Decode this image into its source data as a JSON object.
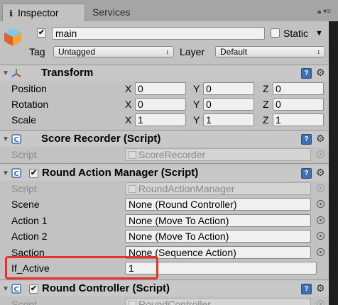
{
  "tabs": {
    "inspector_label": "Inspector",
    "services_label": "Services",
    "lock_icon": "lock-icon",
    "menu_icon": "menu-icon"
  },
  "gameobject": {
    "active_checked": true,
    "name": "main",
    "static_label": "Static",
    "tag_label": "Tag",
    "tag_value": "Untagged",
    "layer_label": "Layer",
    "layer_value": "Default"
  },
  "transform": {
    "title": "Transform",
    "rows": [
      {
        "label": "Position",
        "x": "0",
        "y": "0",
        "z": "0"
      },
      {
        "label": "Rotation",
        "x": "0",
        "y": "0",
        "z": "0"
      },
      {
        "label": "Scale",
        "x": "1",
        "y": "1",
        "z": "1"
      }
    ],
    "axis_x": "X",
    "axis_y": "Y",
    "axis_z": "Z"
  },
  "score_recorder": {
    "title": "Score Recorder (Script)",
    "script_label": "Script",
    "script_value": "ScoreRecorder"
  },
  "round_action_manager": {
    "title": "Round Action Manager (Script)",
    "script_label": "Script",
    "script_value": "RoundActionManager",
    "scene_label": "Scene",
    "scene_value": "None (Round Controller)",
    "action1_label": "Action 1",
    "action1_value": "None (Move To Action)",
    "action2_label": "Action 2",
    "action2_value": "None (Move To Action)",
    "saction_label": "Saction",
    "saction_value": "None (Sequence Action)",
    "ifactive_label": "If_Active",
    "ifactive_value": "1"
  },
  "round_controller": {
    "title": "Round Controller (Script)",
    "script_label": "Script",
    "script_value": "RoundController"
  },
  "colors": {
    "panel_bg": "#c2c2c2",
    "highlight": "#e5322c",
    "help_icon": "#3c6fb4"
  }
}
